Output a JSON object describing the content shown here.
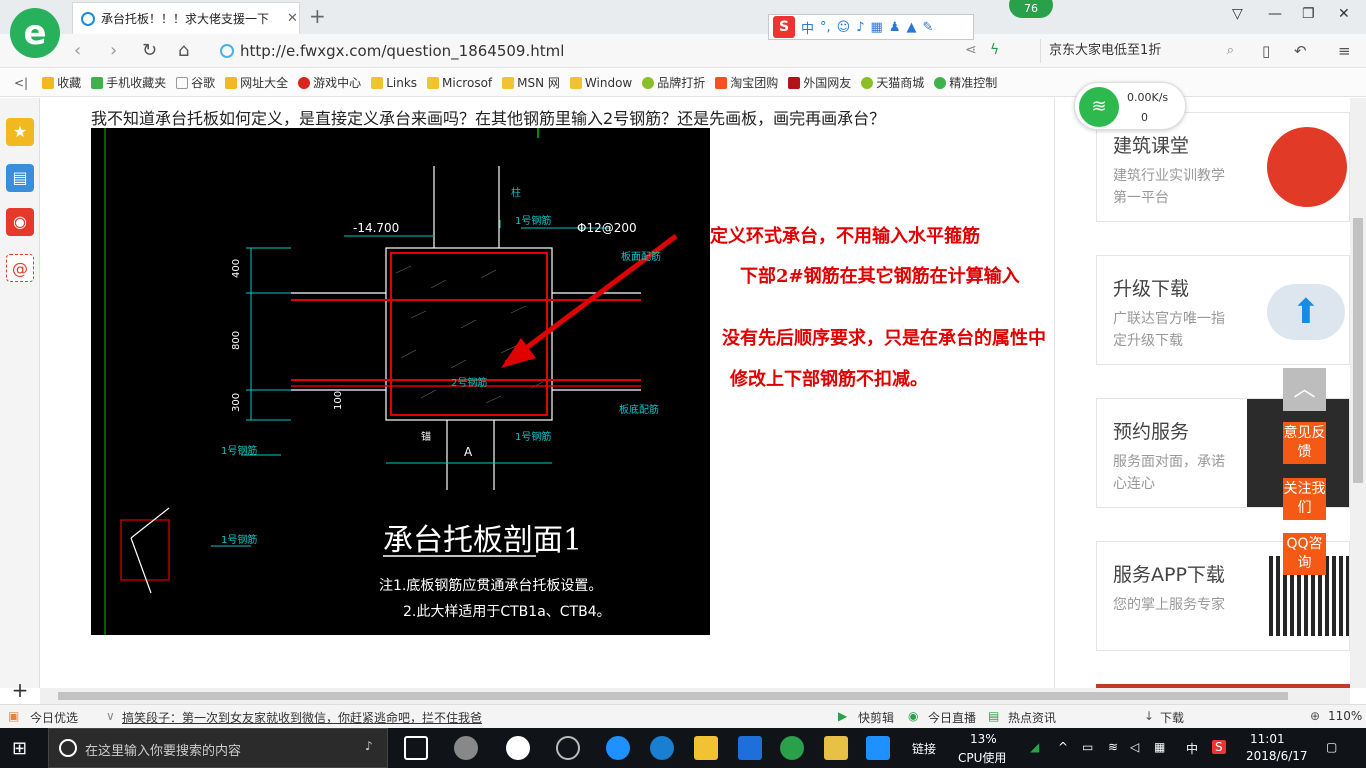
{
  "browser": {
    "tab_title": "承台托板！！！求大佬支援一下",
    "tab_close": "✕",
    "new_tab": "+",
    "url": "http://e.fwxgx.com/question_1864509.html",
    "search_text": "京东大家电低至1折",
    "badge": "76",
    "sogou_cn": "中"
  },
  "bookmarks": [
    {
      "label": "收藏",
      "icon": "star-icon"
    },
    {
      "label": "手机收藏夹",
      "icon": "phone-icon"
    },
    {
      "label": "谷歌",
      "icon": "page-icon"
    },
    {
      "label": "网址大全",
      "icon": "star-icon"
    },
    {
      "label": "游戏中心",
      "icon": "game-icon"
    },
    {
      "label": "Links",
      "icon": "folder-icon"
    },
    {
      "label": "Microsof",
      "icon": "folder-icon"
    },
    {
      "label": "MSN 网",
      "icon": "folder-icon"
    },
    {
      "label": "Window",
      "icon": "folder-icon"
    },
    {
      "label": "品牌打折",
      "icon": "leaf-icon"
    },
    {
      "label": "淘宝团购",
      "icon": "taobao-icon"
    },
    {
      "label": "外国网友",
      "icon": "bookmark-icon"
    },
    {
      "label": "天猫商城",
      "icon": "leaf-icon"
    },
    {
      "label": "精准控制",
      "icon": "wechat-icon"
    }
  ],
  "speed": {
    "down": "0.00K/s",
    "up": "0"
  },
  "question": "我不知道承台托板如何定义，是直接定义承台来画吗？在其他钢筋里输入2号钢筋？还是先画板，画完再画承台？",
  "cad": {
    "title": "承台托板剖面1",
    "note1": "注1.底板钢筋应贯通承台托板设置。",
    "note2": "2.此大样适用于CTB1a、CTB4。",
    "elev": "-14.700",
    "rebar_spec": "Φ12@200",
    "bar1": "1号钢筋",
    "bar2": "2号钢筋",
    "dim400": "400",
    "dim800": "800",
    "dim300": "300",
    "dim100": "100",
    "labelA": "A",
    "col": "柱",
    "edge_bar": "板面配筋",
    "bottom_bar": "板底配筋",
    "anchor": "锚"
  },
  "answer": {
    "line1": "定义环式承台，不用输入水平箍筋",
    "line2": "下部2#钢筋在其它钢筋在计算输入",
    "line3": "没有先后顺序要求，只是在承台的属性中",
    "line4": "修改上下部钢筋不扣减。"
  },
  "right_cards": [
    {
      "title": "建筑课堂",
      "desc": "建筑行业实训教学第一平台"
    },
    {
      "title": "升级下载",
      "desc": "广联达官方唯一指定升级下载"
    },
    {
      "title": "预约服务",
      "desc": "服务面对面，承诺心连心"
    },
    {
      "title": "服务APP下载",
      "desc": "您的掌上服务专家"
    }
  ],
  "float_buttons": [
    "意见反馈",
    "关注我们",
    "QQ咨询"
  ],
  "statusbar": {
    "today": "今日优选",
    "headline": "搞笑段子：第一次到女友家就收到微信，你赶紧逃命吧，拦不住我爸",
    "quickcut": "快剪辑",
    "live": "今日直播",
    "news": "热点资讯",
    "download": "下载",
    "zoom": "110%"
  },
  "taskbar": {
    "search_placeholder": "在这里输入你要搜索的内容",
    "link": "链接",
    "cpu_pct": "13%",
    "cpu_label": "CPU使用",
    "ime": "中",
    "time": "11:01",
    "date": "2018/6/17"
  },
  "colors": {
    "accent_red": "#e00000",
    "cad_bg": "#000000",
    "cad_cyan": "#00c8c8",
    "brand_orange": "#f45a14"
  }
}
